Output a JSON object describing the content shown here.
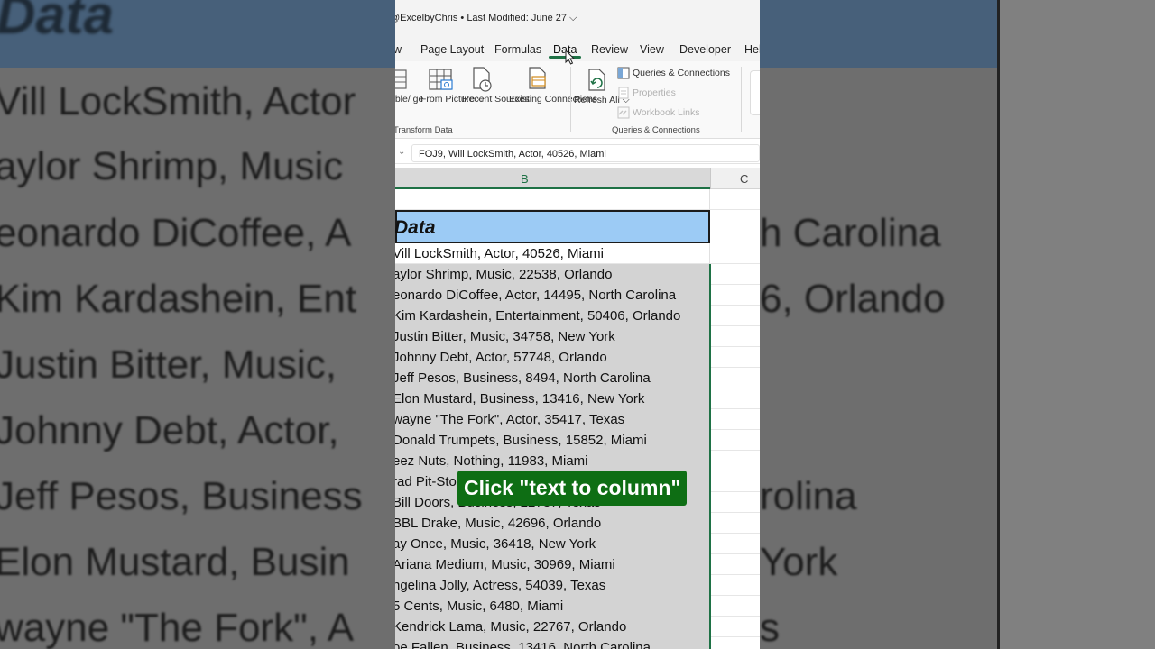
{
  "background": {
    "header": "Data",
    "left_rows": [
      "Vill LockSmith, Actor",
      "aylor Shrimp, Music",
      "eonardo DiCoffee, A",
      "Kim Kardashein, Ent",
      "Justin Bitter, Music,",
      "Johnny Debt, Actor,",
      "Jeff Pesos, Business",
      "Elon Mustard, Busin",
      "wayne \"The Fork\", A"
    ],
    "right_rows": [
      "h Carolina",
      "6, Orlando",
      "rolina",
      "York",
      "s"
    ]
  },
  "titlebar": {
    "text": "@ExcelbyChris • Last Modified: June 27 ⌵"
  },
  "tabs": [
    "w",
    "Page Layout",
    "Formulas",
    "Data",
    "Review",
    "View",
    "Developer",
    "Hel"
  ],
  "ribbon": {
    "from_table_label": "able/ ge",
    "from_picture_label": "From Picture ⌵",
    "recent_sources_label": "Recent Sources",
    "existing_connections_label": "Existing Connections",
    "refresh_all_label": "Refresh All ⌵",
    "queries_connections": "Queries & Connections",
    "properties": "Properties",
    "workbook_links": "Workbook Links",
    "group_transform": "Transform Data",
    "group_queries": "Queries & Connections"
  },
  "formula_bar": {
    "value": "FOJ9, Will LockSmith, Actor, 40526, Miami"
  },
  "columns": {
    "b": "B",
    "c": "C"
  },
  "sheet": {
    "header": "Data",
    "rows": [
      "Vill LockSmith, Actor, 40526, Miami",
      "aylor Shrimp, Music, 22538, Orlando",
      "eonardo DiCoffee, Actor, 14495, North Carolina",
      "Kim Kardashein, Entertainment, 50406, Orlando",
      "Justin Bitter, Music, 34758, New York",
      "Johnny Debt, Actor, 57748, Orlando",
      "Jeff Pesos, Business, 8494, North Carolina",
      "Elon Mustard, Business, 13416, New York",
      "wayne \"The Fork\", Actor, 35417, Texas",
      "Donald Trumpets, Business, 15852, Miami",
      "eez Nuts, Nothing, 11983, Miami",
      "rad Pit-Sto",
      "Bill Doors, Business, 22737, Texas",
      "BBL Drake, Music, 42696, Orlando",
      "ay Once, Music, 36418, New York",
      "Ariana Medium, Music, 30969, Miami",
      "ngelina Jolly, Actress, 54039, Texas",
      "5 Cents, Music, 6480, Miami",
      "Kendrick Lama, Music, 22767, Orlando",
      "oe Fallen, Business, 13416, North Carolina"
    ]
  },
  "caption": "Click \"text to column\""
}
